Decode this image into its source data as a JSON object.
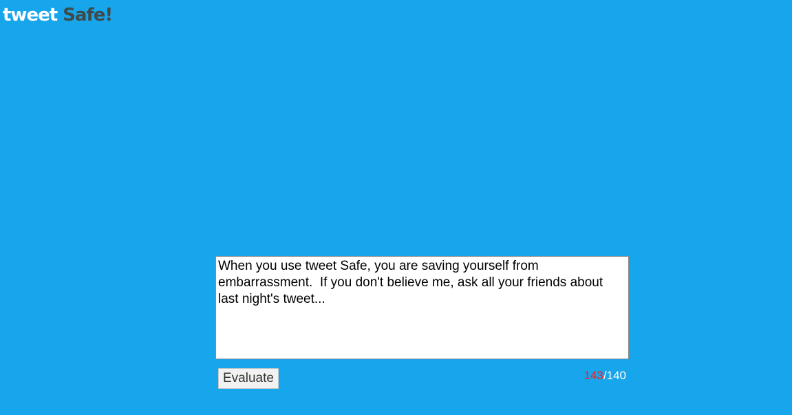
{
  "brand": {
    "part1": "tweet",
    "part2": "Safe!",
    "colors": {
      "background": "#17a5eb",
      "part1": "#ffffff",
      "part2": "#3f4a4a"
    }
  },
  "composer": {
    "text": "When you use tweet Safe, you are saving yourself from embarrassment.  If you don't believe me, ask all your friends about last night's tweet...",
    "evaluate_label": "Evaluate",
    "counter": {
      "current": "143",
      "separator": "/",
      "max": "140",
      "over_limit_color": "#ff1a1a"
    }
  }
}
